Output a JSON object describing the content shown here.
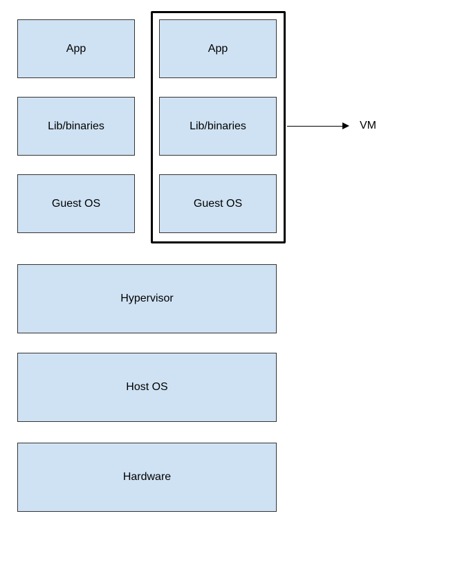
{
  "diagram": {
    "stack1": {
      "app": "App",
      "lib": "Lib/binaries",
      "guestos": "Guest OS"
    },
    "stack2": {
      "app": "App",
      "lib": "Lib/binaries",
      "guestos": "Guest OS"
    },
    "base": {
      "hypervisor": "Hypervisor",
      "hostos": "Host OS",
      "hardware": "Hardware"
    },
    "annotation": {
      "vm": "VM"
    }
  }
}
